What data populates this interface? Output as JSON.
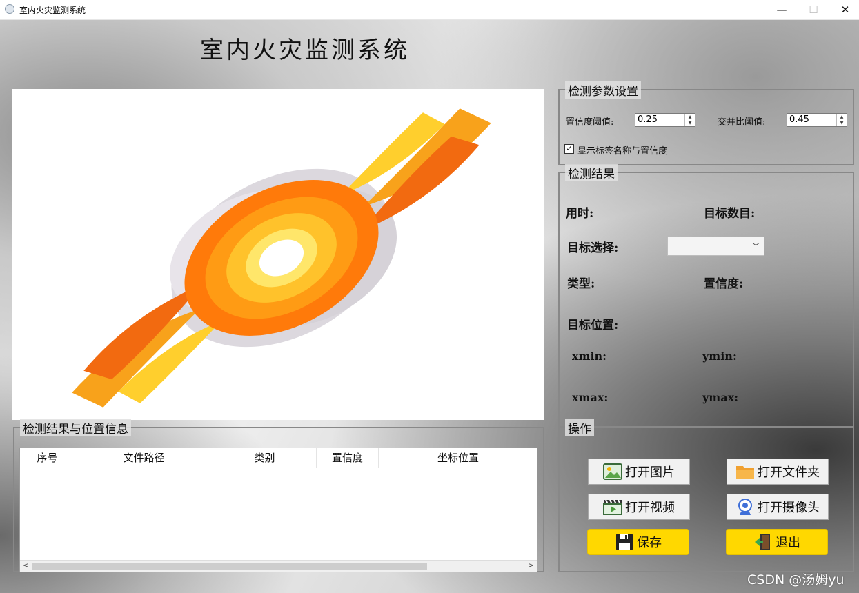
{
  "window": {
    "title": "室内火灾监测系统",
    "controls": {
      "minimize": "—",
      "maximize": "☐",
      "close": "✕"
    }
  },
  "app_title": "室内火灾监测系统",
  "image_view": {
    "content": "explosion-illustration"
  },
  "params": {
    "title": "检测参数设置",
    "conf_label": "置信度阈值:",
    "conf_value": "0.25",
    "iou_label": "交并比阈值:",
    "iou_value": "0.45",
    "show_labels_checked": true,
    "show_labels_text": "显示标签名称与置信度"
  },
  "results": {
    "title": "检测结果",
    "time_label": "用时:",
    "count_label": "目标数目:",
    "select_label": "目标选择:",
    "select_value": "",
    "type_label": "类型:",
    "confidence_label": "置信度:",
    "position_label": "目标位置:",
    "xmin_label": "xmin:",
    "ymin_label": "ymin:",
    "xmax_label": "xmax:",
    "ymax_label": "ymax:"
  },
  "operations": {
    "title": "操作",
    "open_image": "打开图片",
    "open_folder": "打开文件夹",
    "open_video": "打开视频",
    "open_camera": "打开摄像头",
    "save": "保存",
    "exit": "退出"
  },
  "table": {
    "title": "检测结果与位置信息",
    "columns": [
      "序号",
      "文件路径",
      "类别",
      "置信度",
      "坐标位置"
    ],
    "rows": []
  },
  "watermark": "CSDN @汤姆yu",
  "colors": {
    "yellow_button": "#ffd800",
    "frame_border": "#888888"
  }
}
